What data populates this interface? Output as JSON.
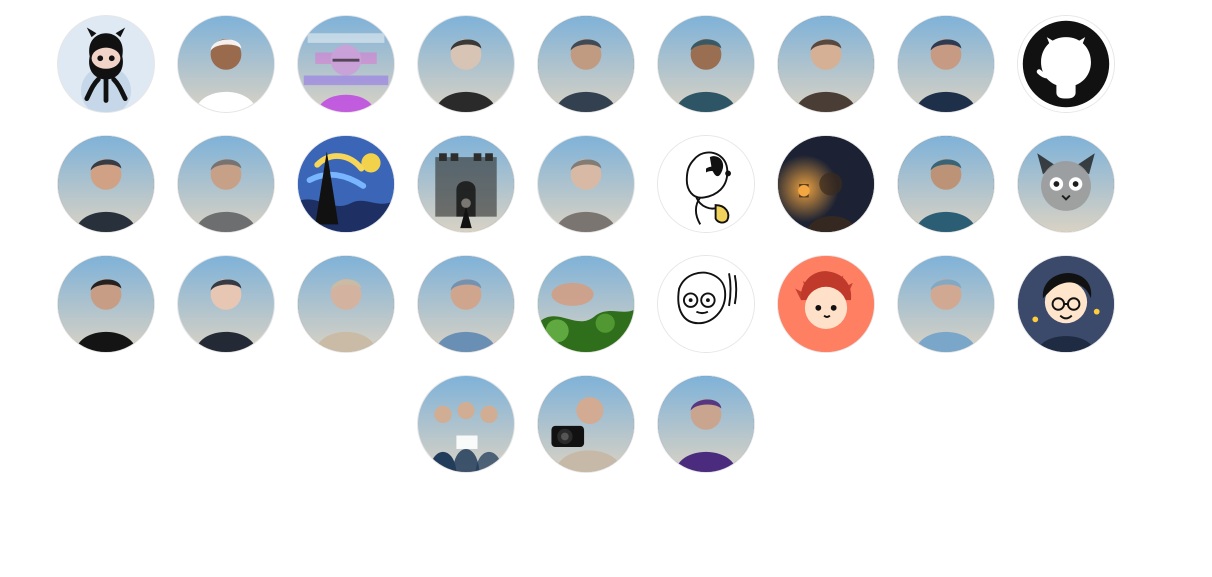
{
  "contributors": [
    {
      "icon": "octocat-icon",
      "bg": "#dfe9f3",
      "fg": "#111111",
      "skin": "#ffffff",
      "top": "#dfe9f3",
      "bottom": "#b9cfe3"
    },
    {
      "icon": "person-photo",
      "bg": "#8ab7d6",
      "fg": "#ffffff",
      "skin": "#9a6a4d",
      "top": "#7fb2d8",
      "bottom": "#d9d2c4"
    },
    {
      "icon": "glitch-photo",
      "bg": "#d8b8ea",
      "fg": "#c04fe0",
      "skin": "#caa0d8",
      "top": "#eac9f4",
      "bottom": "#d35ae2"
    },
    {
      "icon": "person-photo",
      "bg": "#f2f2f2",
      "fg": "#2a2a2a",
      "skin": "#d8c4b4",
      "top": "#fafafa",
      "bottom": "#e6e6e6"
    },
    {
      "icon": "person-photo",
      "bg": "#6a5442",
      "fg": "#33404f",
      "skin": "#c19a82",
      "top": "#8a6d58",
      "bottom": "#4b3a2e"
    },
    {
      "icon": "person-photo",
      "bg": "#7f8f6a",
      "fg": "#2d5565",
      "skin": "#9a6e51",
      "top": "#c7b9a3",
      "bottom": "#5b6a48"
    },
    {
      "icon": "person-photo",
      "bg": "#5e4a3d",
      "fg": "#4a3d35",
      "skin": "#d6b095",
      "top": "#3d302a",
      "bottom": "#8d7463"
    },
    {
      "icon": "person-photo",
      "bg": "#4a78b8",
      "fg": "#1e2f4a",
      "skin": "#c79b83",
      "top": "#5a8ed3",
      "bottom": "#213659"
    },
    {
      "icon": "github-logo-icon",
      "bg": "#ffffff",
      "fg": "#111111",
      "skin": "#ffffff",
      "top": "#ffffff",
      "bottom": "#ffffff"
    },
    {
      "icon": "person-photo",
      "bg": "#7b5343",
      "fg": "#28303c",
      "skin": "#d0a184",
      "top": "#a6705a",
      "bottom": "#3e2f2a"
    },
    {
      "icon": "person-photo",
      "bg": "#8d7a58",
      "fg": "#6d6e70",
      "skin": "#c6a087",
      "top": "#9eb07a",
      "bottom": "#6f5a4c"
    },
    {
      "icon": "starry-night-icon",
      "bg": "#2a4c9a",
      "fg": "#111111",
      "skin": "#f1d24a",
      "top": "#3b66b7",
      "bottom": "#1d2f63"
    },
    {
      "icon": "castle-photo",
      "bg": "#5f5f5d",
      "fg": "#2d2d2b",
      "skin": "#7a7772",
      "top": "#8d8a85",
      "bottom": "#343331"
    },
    {
      "icon": "person-photo",
      "bg": "#d8d8d4",
      "fg": "#7a7570",
      "skin": "#d8b9a5",
      "top": "#f1f1ee",
      "bottom": "#b8b4ae"
    },
    {
      "icon": "snoopy-icon",
      "bg": "#ffffff",
      "fg": "#111111",
      "skin": "#f1d35b",
      "top": "#ffffff",
      "bottom": "#f5f5f5"
    },
    {
      "icon": "lantern-photo",
      "bg": "#101826",
      "fg": "#3b2a1d",
      "skin": "#f4a640",
      "top": "#1c2233",
      "bottom": "#0c0f16"
    },
    {
      "icon": "person-photo",
      "bg": "#1f3027",
      "fg": "#2b5e75",
      "skin": "#bd9378",
      "top": "#3d5a46",
      "bottom": "#111a15"
    },
    {
      "icon": "cat-photo",
      "bg": "#5b5b5b",
      "fg": "#1e1e1e",
      "skin": "#9b9b9b",
      "top": "#7a7a7a",
      "bottom": "#2f2f2f"
    },
    {
      "icon": "person-photo",
      "bg": "#7b7a5b",
      "fg": "#141414",
      "skin": "#c79d86",
      "top": "#dbe3ef",
      "bottom": "#4f4d38"
    },
    {
      "icon": "person-photo",
      "bg": "#e8edf1",
      "fg": "#232a35",
      "skin": "#e7c6b3",
      "top": "#f2f5f8",
      "bottom": "#dbe2e8"
    },
    {
      "icon": "person-photo",
      "bg": "#6e5a47",
      "fg": "#c9bba5",
      "skin": "#d3b39f",
      "top": "#4a3a31",
      "bottom": "#8e7767"
    },
    {
      "icon": "person-photo",
      "bg": "#b35741",
      "fg": "#6a8fb4",
      "skin": "#d0a58e",
      "top": "#7c3d2e",
      "bottom": "#c7d4e4"
    },
    {
      "icon": "leaves-photo",
      "bg": "#4c8b2b",
      "fg": "#2f6e1a",
      "skin": "#d29f84",
      "top": "#7fbf4a",
      "bottom": "#2f5b1a"
    },
    {
      "icon": "sketch-icon",
      "bg": "#ffffff",
      "fg": "#111111",
      "skin": "#ffffff",
      "top": "#ffffff",
      "bottom": "#f7f7f7"
    },
    {
      "icon": "cartoon-face-icon",
      "bg": "#ff7f63",
      "fg": "#c03a2b",
      "skin": "#ffe0c8",
      "top": "#ff7f63",
      "bottom": "#ff7f63"
    },
    {
      "icon": "person-photo",
      "bg": "#7f8790",
      "fg": "#7aa7c9",
      "skin": "#d1a992",
      "top": "#c7ced5",
      "bottom": "#49515a"
    },
    {
      "icon": "cartoon-boy-icon",
      "bg": "#3b4a6a",
      "fg": "#111111",
      "skin": "#ffe5cc",
      "top": "#3b4a6a",
      "bottom": "#1f2b42"
    },
    {
      "icon": "group-photo",
      "bg": "#dcdcdc",
      "fg": "#223c5b",
      "skin": "#d0ad93",
      "top": "#f0f0f0",
      "bottom": "#a2a2a2"
    },
    {
      "icon": "camera-photo",
      "bg": "#6d5a4c",
      "fg": "#c7b9a7",
      "skin": "#d2ab92",
      "top": "#8c7766",
      "bottom": "#3d332c"
    },
    {
      "icon": "person-photo",
      "bg": "#2f4ea6",
      "fg": "#4a2b7d",
      "skin": "#c9a58f",
      "top": "#3f67c8",
      "bottom": "#1c2b5a"
    }
  ]
}
